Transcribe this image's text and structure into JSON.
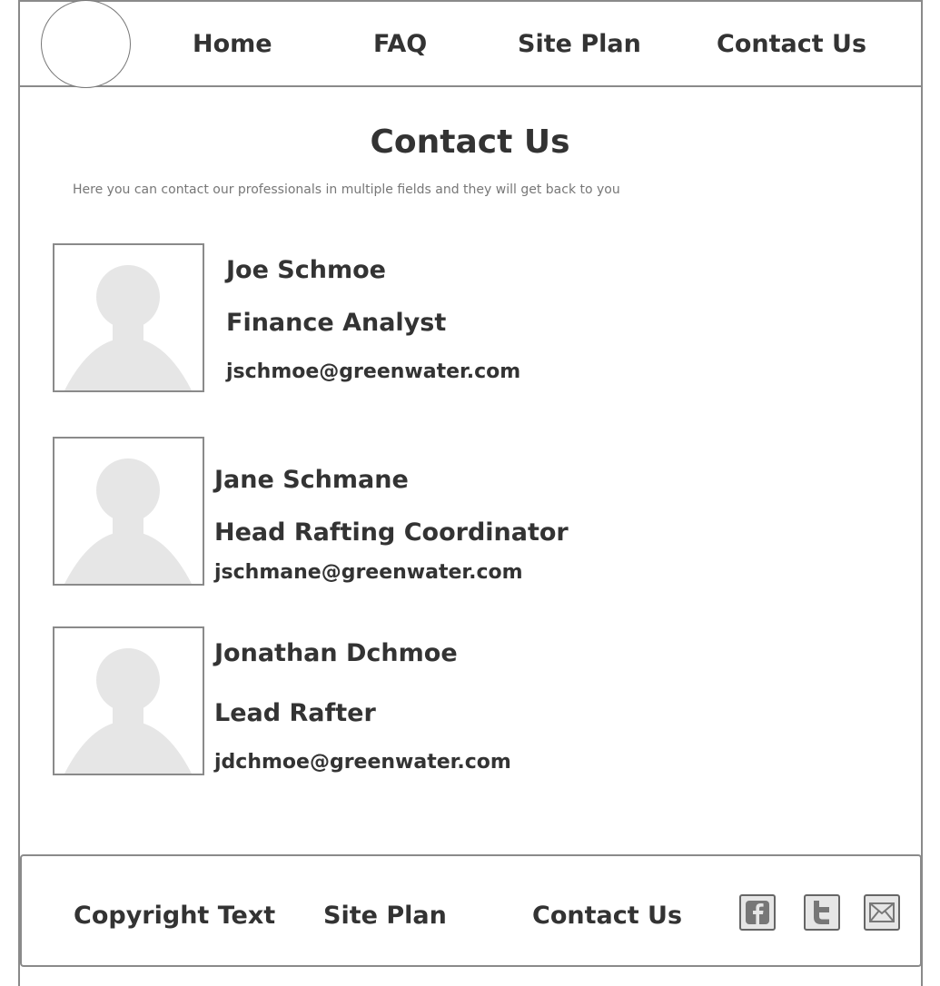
{
  "header": {
    "nav": [
      {
        "label": "Home"
      },
      {
        "label": "FAQ"
      },
      {
        "label": "Site Plan"
      },
      {
        "label": "Contact Us"
      }
    ]
  },
  "main": {
    "title": "Contact Us",
    "subtitle": "Here you can contact our professionals in multiple fields and they will get back to you",
    "contacts": [
      {
        "name": "Joe Schmoe",
        "role": "Finance Analyst",
        "email": "jschmoe@greenwater.com"
      },
      {
        "name": "Jane Schmane",
        "role": "Head Rafting Coordinator",
        "email": "jschmane@greenwater.com"
      },
      {
        "name": "Jonathan Dchmoe",
        "role": "Lead Rafter",
        "email": "jdchmoe@greenwater.com"
      }
    ]
  },
  "footer": {
    "copyright": "Copyright Text",
    "links": [
      {
        "label": "Site Plan"
      },
      {
        "label": "Contact Us"
      }
    ],
    "social_icons": [
      "facebook-icon",
      "twitter-icon",
      "email-icon"
    ]
  },
  "colors": {
    "border": "#8a8a8a",
    "text": "#333333",
    "muted_text": "#777777",
    "placeholder_fill": "#e6e6e6"
  }
}
